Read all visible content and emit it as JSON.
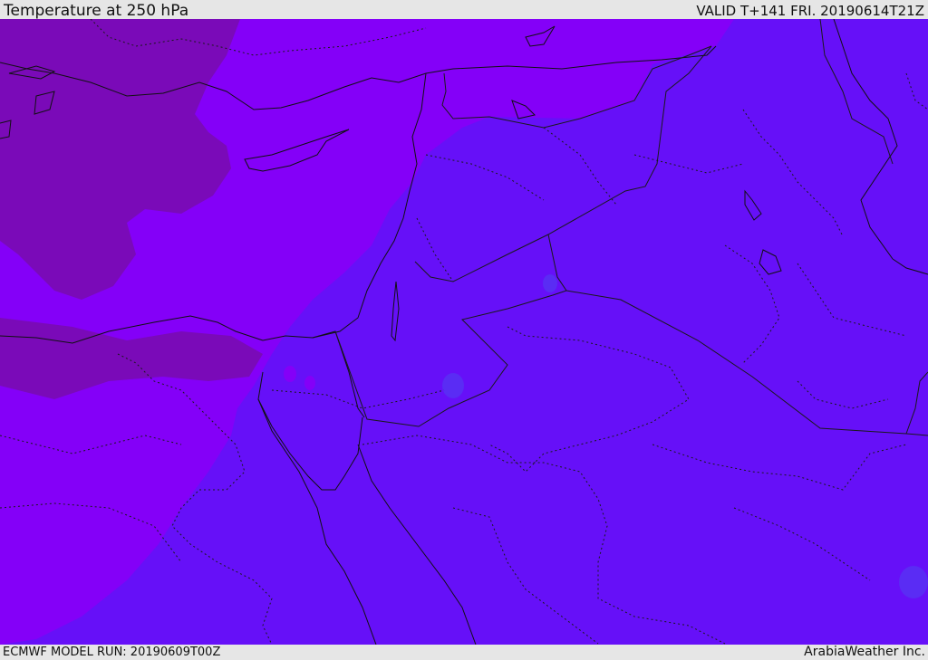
{
  "header": {
    "title": "Temperature at 250 hPa",
    "valid": "VALID T+141 FRI. 20190614T21Z"
  },
  "footer": {
    "model_run": "ECMWF MODEL RUN: 20190609T00Z",
    "credit": "ArabiaWeather Inc."
  },
  "map": {
    "field": "temperature",
    "level": "250 hPa",
    "colors": {
      "coldest_zone": "#7a0ab8",
      "cold_zone": "#8400f8",
      "mid_zone": "#6610f8",
      "warm_patch": "#5a2cf4",
      "coastline": "#111111",
      "border": "#1a1a1a"
    }
  }
}
